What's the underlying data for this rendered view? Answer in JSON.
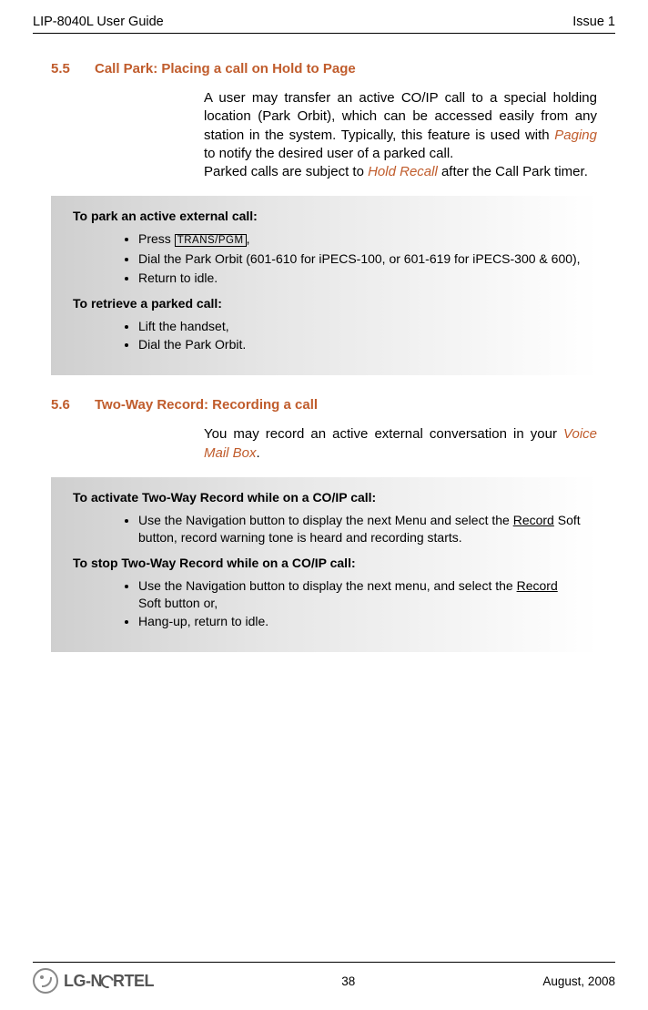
{
  "header": {
    "left": "LIP-8040L User Guide",
    "right": "Issue 1"
  },
  "sections": [
    {
      "num": "5.5",
      "title": "Call Park: Placing a call on Hold to Page",
      "paras": [
        {
          "pre": "A user may transfer an active CO/IP call to a special holding location (Park Orbit), which can be accessed easily from any station in the system.  Typically, this feature is used with ",
          "link": "Paging",
          "post": " to notify the desired user of a parked call."
        },
        {
          "pre": "Parked calls are subject to ",
          "link": "Hold Recall",
          "post": " after the Call Park timer."
        }
      ],
      "box": [
        {
          "type": "heading",
          "text": "To park an active external call:"
        },
        {
          "type": "list",
          "items": [
            {
              "pre": "Press ",
              "key": "TRANS/PGM",
              "post": ","
            },
            {
              "text": "Dial the Park Orbit (601-610 for iPECS-100, or 601-619 for iPECS-300 & 600),"
            },
            {
              "text": "Return to idle."
            }
          ]
        },
        {
          "type": "heading",
          "text": "To retrieve a parked call:"
        },
        {
          "type": "list",
          "items": [
            {
              "text": "Lift the handset,"
            },
            {
              "text": "Dial the Park Orbit."
            }
          ]
        }
      ]
    },
    {
      "num": "5.6",
      "title": "Two-Way Record: Recording a call",
      "paras": [
        {
          "pre": "You may record an active external conversation in your ",
          "link": "Voice Mail Box",
          "post": "."
        }
      ],
      "box": [
        {
          "type": "heading",
          "text": "To activate Two-Way Record while on a CO/IP call:"
        },
        {
          "type": "list",
          "items": [
            {
              "pre": "Use the Navigation button to display the next Menu and select the ",
              "soft": "Record",
              "post": " Soft button, record warning tone is heard and recording starts."
            }
          ]
        },
        {
          "type": "heading",
          "text": "To stop Two-Way Record while on a CO/IP call:"
        },
        {
          "type": "list",
          "items": [
            {
              "pre": "Use the Navigation button to display the next menu, and select the ",
              "soft": "Record",
              "post": " Soft button or,"
            },
            {
              "text": "Hang-up, return to idle."
            }
          ]
        }
      ]
    }
  ],
  "footer": {
    "page": "38",
    "date": "August, 2008",
    "logo_lg": "LG",
    "logo_nortel": "RTEL"
  }
}
